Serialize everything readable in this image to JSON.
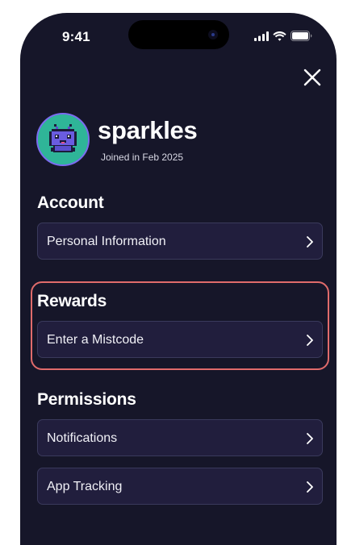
{
  "status_bar": {
    "time": "9:41"
  },
  "profile": {
    "username": "sparkles",
    "joined": "Joined in Feb 2025"
  },
  "sections": {
    "account": {
      "title": "Account",
      "items": [
        {
          "label": "Personal Information"
        }
      ]
    },
    "rewards": {
      "title": "Rewards",
      "items": [
        {
          "label": "Enter a Mistcode"
        }
      ]
    },
    "permissions": {
      "title": "Permissions",
      "items": [
        {
          "label": "Notifications"
        },
        {
          "label": "App Tracking"
        }
      ]
    }
  },
  "colors": {
    "background": "#161629",
    "row_background": "#211e3d",
    "row_border": "#3a3a5c",
    "highlight": "#e06b6b",
    "avatar_ring": "#7b6cf0",
    "avatar_bg": "#2fb598"
  },
  "icons": [
    "signal-icon",
    "wifi-icon",
    "battery-icon",
    "close-icon",
    "chevron-right-icon"
  ]
}
